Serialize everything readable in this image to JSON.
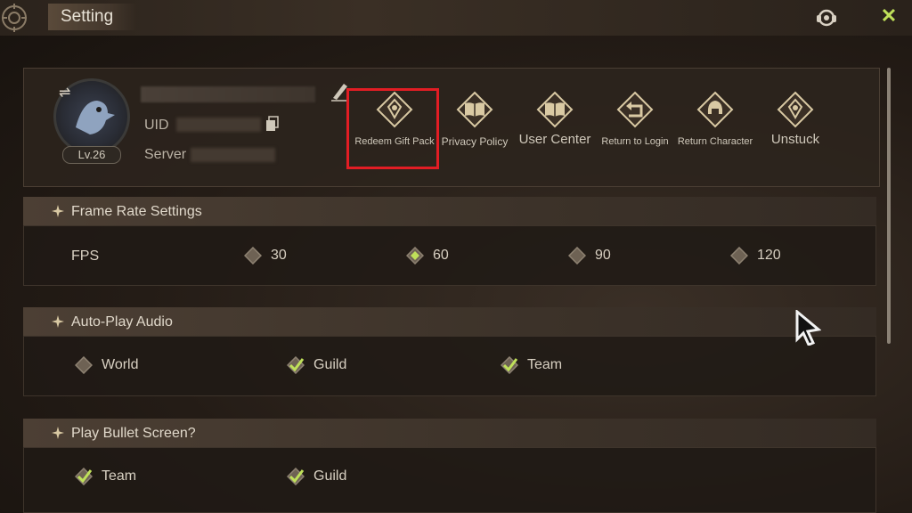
{
  "header": {
    "title": "Setting"
  },
  "profile": {
    "level": "Lv.26",
    "uid_label": "UID",
    "server_label": "Server"
  },
  "actions": [
    {
      "label": "Redeem Gift Pack",
      "icon": "gift-diamond-icon"
    },
    {
      "label": "Privacy Policy",
      "icon": "book-icon"
    },
    {
      "label": "User Center",
      "icon": "book-icon"
    },
    {
      "label": "Return to Login",
      "icon": "return-arrow-icon"
    },
    {
      "label": "Return Character",
      "icon": "helmet-icon"
    },
    {
      "label": "Unstuck",
      "icon": "diamond-emblem-icon"
    }
  ],
  "frame_rate": {
    "title": "Frame Rate Settings",
    "label": "FPS",
    "options": [
      {
        "label": "30",
        "selected": false
      },
      {
        "label": "60",
        "selected": true
      },
      {
        "label": "90",
        "selected": false
      },
      {
        "label": "120",
        "selected": false
      }
    ]
  },
  "auto_play_audio": {
    "title": "Auto-Play Audio",
    "options": [
      {
        "label": "World",
        "checked": false
      },
      {
        "label": "Guild",
        "checked": true
      },
      {
        "label": "Team",
        "checked": true
      }
    ]
  },
  "bullet_screen": {
    "title": "Play Bullet Screen?",
    "options": [
      {
        "label": "Team",
        "checked": true
      },
      {
        "label": "Guild",
        "checked": true
      }
    ]
  },
  "colors": {
    "accent": "#bfe05a",
    "highlight": "#e21d24",
    "gold": "#d9c9a3"
  }
}
